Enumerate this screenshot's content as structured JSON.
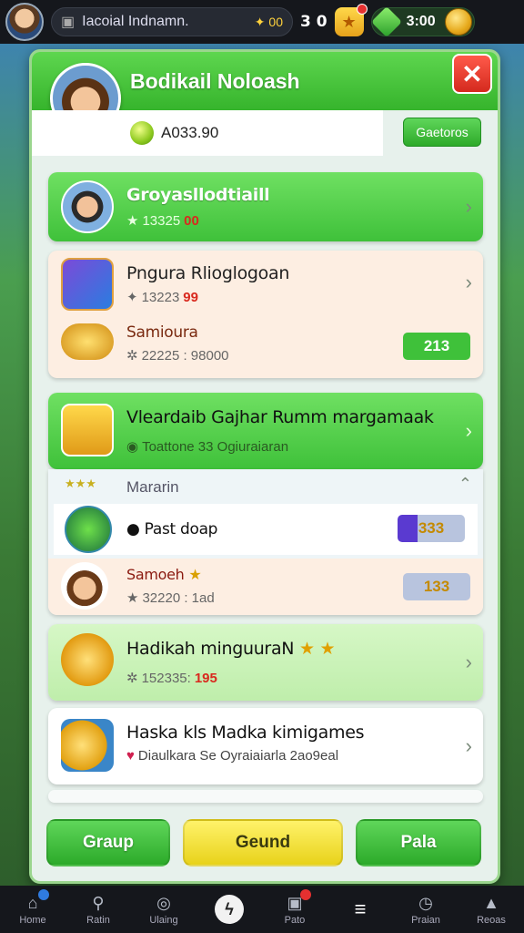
{
  "topbar": {
    "search_text": "Ιacoial Indnamn.",
    "search_gold": "00",
    "stat": "3 0",
    "gems": "3:00"
  },
  "panel": {
    "title": "Bodikail Noloash",
    "balance": "A033.90",
    "gainers_label": "Gaetoros",
    "close_symbol": "✕"
  },
  "items": [
    {
      "title": "Groyasllodtiaill",
      "meta": "13325",
      "value": "00",
      "style": "green"
    },
    {
      "title": "Pngura Rlioglogoan",
      "meta": "13223",
      "value": "99",
      "style": "peach"
    },
    {
      "title": "Samioura",
      "meta": "22225 : 98000",
      "pill": "213",
      "style": "peach"
    },
    {
      "title": "Vleardaib Gajhar Rumm margamaak",
      "meta": "Toattone 33  Ogiuraiaran",
      "style": "green"
    },
    {
      "title": "Mararin",
      "style": "white"
    },
    {
      "title": "Past doap",
      "pill": "333",
      "style": "white"
    },
    {
      "title": "Samoeh",
      "meta": "32220 : 1ad",
      "pill": "133",
      "style": "peach"
    },
    {
      "title": "Hadikah minguuraN",
      "meta": "152335:",
      "value": "195",
      "style": "lightgreen"
    },
    {
      "title": "Haska kls Madka kimigames",
      "meta": "Diaulkara Se  Oyraiaiarla 2ao9eal",
      "style": "white"
    }
  ],
  "footer": {
    "left": "Graup",
    "center": "Geund",
    "right": "Pala"
  },
  "nav": [
    "Home",
    "Ratin",
    "Ulaing",
    "",
    "Pato",
    "",
    "Praian",
    "Reoas"
  ],
  "colors": {
    "accent_green": "#3fc13a",
    "close_red": "#d42a1e",
    "gold": "#ffd23c"
  }
}
